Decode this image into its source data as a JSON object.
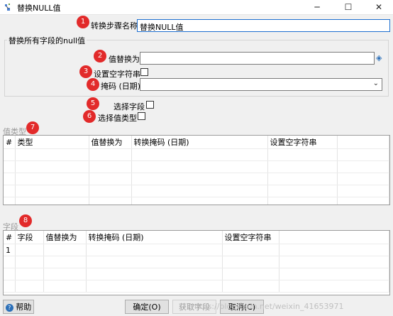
{
  "window": {
    "title": "替换NULL值",
    "minimize": "─",
    "maximize": "☐",
    "close": "✕"
  },
  "step_name": {
    "label": "转换步骤名称",
    "value": "替换NULL值",
    "badge": "1"
  },
  "group_all_fields": {
    "title": "替换所有字段的null值",
    "replace_with": {
      "label": "值替换为",
      "value": "",
      "badge": "2"
    },
    "set_empty": {
      "label": "设置空字符串",
      "badge": "3"
    },
    "mask": {
      "label": "掩码 (日期)",
      "value": "",
      "badge": "4"
    }
  },
  "select_fields": {
    "label": "选择字段",
    "badge": "5"
  },
  "select_value_types": {
    "label": "选择值类型",
    "badge": "6"
  },
  "value_types_section": {
    "title": "值类型",
    "badge": "7",
    "columns": [
      "#",
      "类型",
      "值替换为",
      "转换掩码 (日期)",
      "设置空字符串"
    ],
    "rows": []
  },
  "fields_section": {
    "title": "字段",
    "badge": "8",
    "columns": [
      "#",
      "字段",
      "值替换为",
      "转换掩码 (日期)",
      "设置空字符串"
    ],
    "rows": [
      [
        "1",
        "",
        "",
        "",
        ""
      ]
    ]
  },
  "buttons": {
    "help": "帮助",
    "ok": "确定(O)",
    "get_fields": "获取字段",
    "cancel": "取消(C)"
  },
  "watermark": "https://blog.csdn.net/weixin_41653971"
}
